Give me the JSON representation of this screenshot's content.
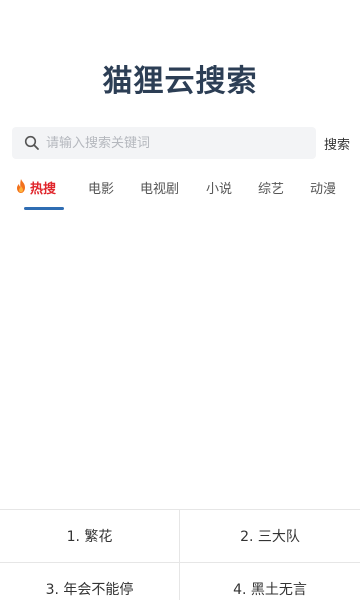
{
  "app": {
    "title": "猫狸云搜索"
  },
  "search": {
    "placeholder": "请输入搜索关键词",
    "value": "",
    "button_label": "搜索"
  },
  "tabs": [
    {
      "label": "热搜",
      "icon": "fire-icon",
      "active": true
    },
    {
      "label": "电影"
    },
    {
      "label": "电视剧"
    },
    {
      "label": "小说"
    },
    {
      "label": "综艺"
    },
    {
      "label": "动漫"
    }
  ],
  "hot_list": [
    "1. 繁花",
    "2. 三大队",
    "3. 年会不能停",
    "4. 黑土无言"
  ],
  "colors": {
    "title": "#2c3e55",
    "active_tab": "#e0262c",
    "tab_indicator": "#2f6db3"
  }
}
